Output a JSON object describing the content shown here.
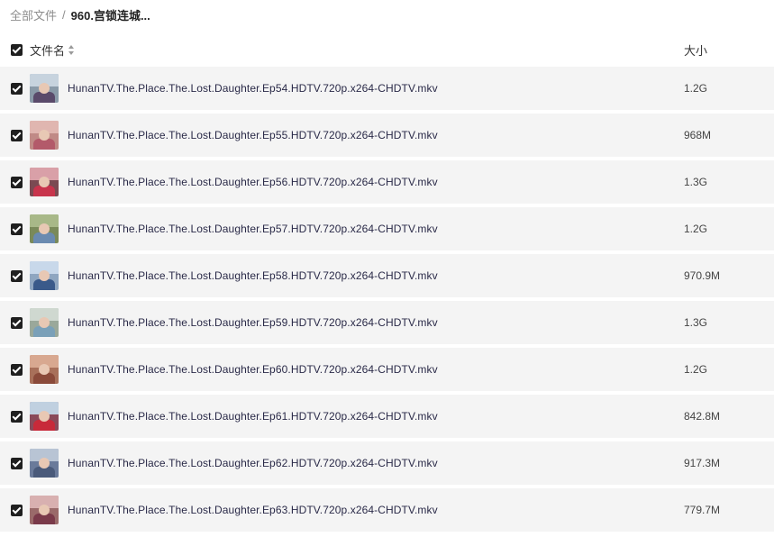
{
  "breadcrumb": {
    "root": "全部文件",
    "separator": "/",
    "current": "960.宫锁连城..."
  },
  "header": {
    "name_label": "文件名",
    "size_label": "大小"
  },
  "files": [
    {
      "name": "HunanTV.The.Place.The.Lost.Daughter.Ep54.HDTV.720p.x264-CHDTV.mkv",
      "size": "1.2G",
      "thumb": {
        "bg": "#8a9aa8",
        "sky": "#c7d3de",
        "cloth": "#5a4a6a"
      }
    },
    {
      "name": "HunanTV.The.Place.The.Lost.Daughter.Ep55.HDTV.720p.x264-CHDTV.mkv",
      "size": "968M",
      "thumb": {
        "bg": "#c08a86",
        "sky": "#e0b6b0",
        "cloth": "#b35a6a"
      }
    },
    {
      "name": "HunanTV.The.Place.The.Lost.Daughter.Ep56.HDTV.720p.x264-CHDTV.mkv",
      "size": "1.3G",
      "thumb": {
        "bg": "#7a4a52",
        "sky": "#d9a0a8",
        "cloth": "#c8344c"
      }
    },
    {
      "name": "HunanTV.The.Place.The.Lost.Daughter.Ep57.HDTV.720p.x264-CHDTV.mkv",
      "size": "1.2G",
      "thumb": {
        "bg": "#7a8a5a",
        "sky": "#a8b888",
        "cloth": "#6a8ab0"
      }
    },
    {
      "name": "HunanTV.The.Place.The.Lost.Daughter.Ep58.HDTV.720p.x264-CHDTV.mkv",
      "size": "970.9M",
      "thumb": {
        "bg": "#8fa6c0",
        "sky": "#c8d8ea",
        "cloth": "#3a5a8a"
      }
    },
    {
      "name": "HunanTV.The.Place.The.Lost.Daughter.Ep59.HDTV.720p.x264-CHDTV.mkv",
      "size": "1.3G",
      "thumb": {
        "bg": "#9aa89a",
        "sky": "#cfd8d0",
        "cloth": "#7aa0b8"
      }
    },
    {
      "name": "HunanTV.The.Place.The.Lost.Daughter.Ep60.HDTV.720p.x264-CHDTV.mkv",
      "size": "1.2G",
      "thumb": {
        "bg": "#a8705a",
        "sky": "#d8a890",
        "cloth": "#8a4a3a"
      }
    },
    {
      "name": "HunanTV.The.Place.The.Lost.Daughter.Ep61.HDTV.720p.x264-CHDTV.mkv",
      "size": "842.8M",
      "thumb": {
        "bg": "#8a4a5a",
        "sky": "#c0d0e0",
        "cloth": "#c82a3a"
      }
    },
    {
      "name": "HunanTV.The.Place.The.Lost.Daughter.Ep62.HDTV.720p.x264-CHDTV.mkv",
      "size": "917.3M",
      "thumb": {
        "bg": "#6a7a9a",
        "sky": "#b8c4d4",
        "cloth": "#4a5a7a"
      }
    },
    {
      "name": "HunanTV.The.Place.The.Lost.Daughter.Ep63.HDTV.720p.x264-CHDTV.mkv",
      "size": "779.7M",
      "thumb": {
        "bg": "#9a6a6a",
        "sky": "#d8b0b0",
        "cloth": "#7a3a4a"
      }
    }
  ]
}
